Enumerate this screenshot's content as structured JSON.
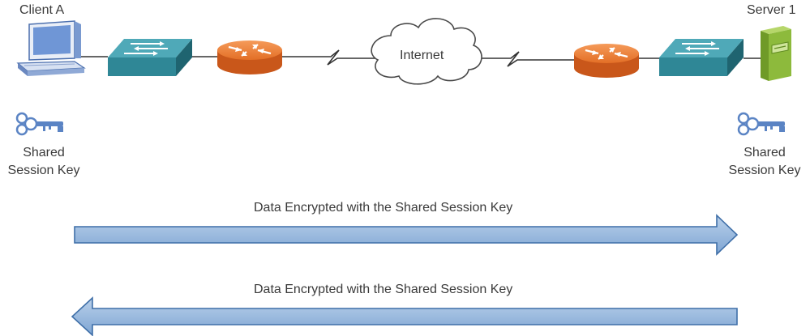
{
  "client": {
    "label": "Client A"
  },
  "server": {
    "label": "Server 1"
  },
  "cloud": {
    "label": "Internet"
  },
  "left_key": {
    "line1": "Shared",
    "line2": "Session Key"
  },
  "right_key": {
    "line1": "Shared",
    "line2": "Session Key"
  },
  "flows": [
    {
      "label": "Data Encrypted with the Shared Session Key",
      "direction": "right"
    },
    {
      "label": "Data Encrypted with the Shared Session Key",
      "direction": "left"
    }
  ],
  "colors": {
    "line": "#333333",
    "router": "#e8762d",
    "switch": "#2e8a99",
    "server": "#8dba3c",
    "key": "#5b84c4",
    "arrow_fill": "#96b7dc",
    "arrow_stroke": "#3f6fa8"
  },
  "icons": [
    "computer-icon",
    "switch-icon",
    "router-icon",
    "cloud-icon",
    "server-icon",
    "key-icon"
  ]
}
